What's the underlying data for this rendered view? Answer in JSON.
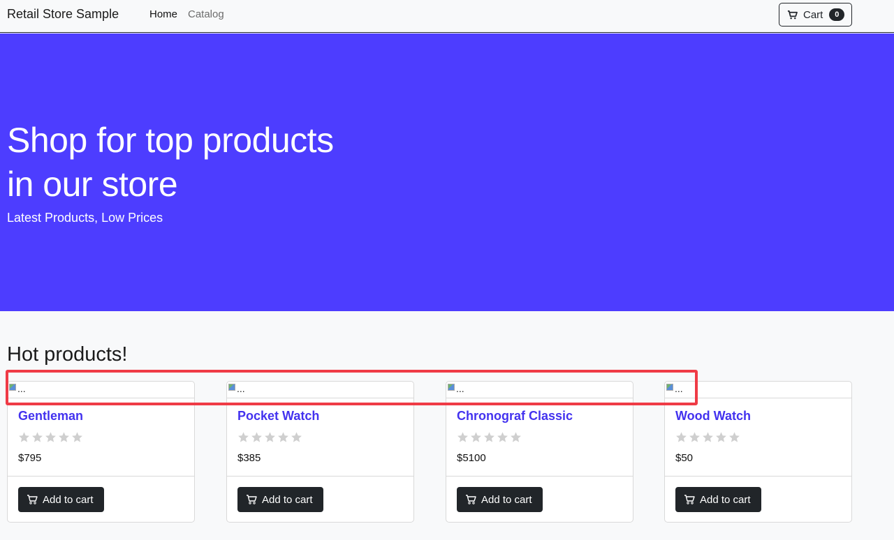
{
  "nav": {
    "brand": "Retail Store Sample",
    "home_label": "Home",
    "catalog_label": "Catalog",
    "cart_label": "Cart",
    "cart_count": "0",
    "cart_icon": "cart-icon"
  },
  "hero": {
    "title_line_1": "Shop for top products",
    "title_line_2": "in our store",
    "subtitle": "Latest Products, Low Prices",
    "background_color": "#4d3dff"
  },
  "section": {
    "title": "Hot products!"
  },
  "highlight": {
    "color": "#ef3b46"
  },
  "products": [
    {
      "image_alt": "...",
      "name": "Gentleman",
      "rating": 0,
      "price": "$795",
      "button_label": "Add to cart"
    },
    {
      "image_alt": "...",
      "name": "Pocket Watch",
      "rating": 0,
      "price": "$385",
      "button_label": "Add to cart"
    },
    {
      "image_alt": "...",
      "name": "Chronograf Classic",
      "rating": 0,
      "price": "$5100",
      "button_label": "Add to cart"
    },
    {
      "image_alt": "...",
      "name": "Wood Watch",
      "rating": 0,
      "price": "$50",
      "button_label": "Add to cart"
    }
  ],
  "colors": {
    "accent": "#4332ef",
    "button_dark": "#212529",
    "star_inactive": "#cfcfcf"
  }
}
